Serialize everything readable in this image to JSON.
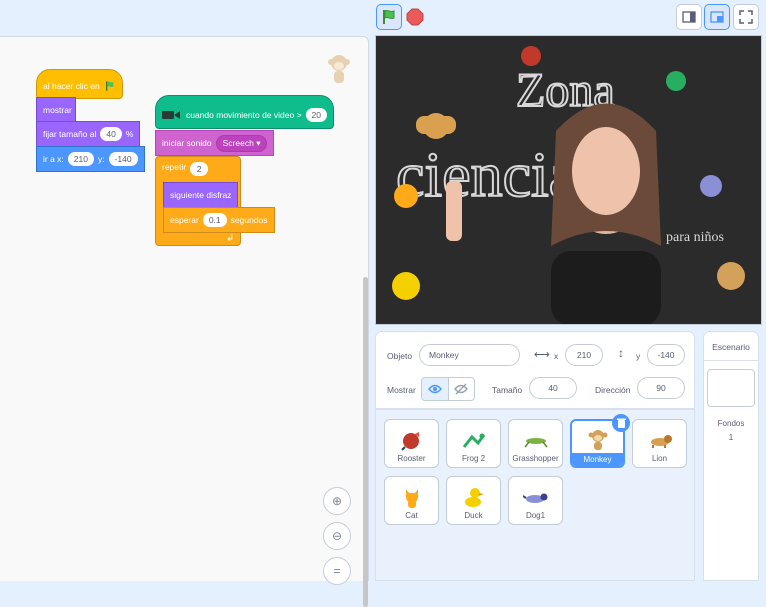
{
  "scripts": {
    "flag_script": {
      "when_flag": "al hacer clic en",
      "show": "mostrar",
      "set_size_label": "fijar tamaño al",
      "set_size_value": "40",
      "set_size_unit": "%",
      "goto_label": "ir a x:",
      "goto_x": "210",
      "goto_y_label": "y:",
      "goto_y": "-140"
    },
    "video_script": {
      "when_motion": "cuando movimiento de video >",
      "motion_value": "20",
      "start_sound": "iniciar sonido",
      "sound_name": "Screech",
      "repeat_label": "repetir",
      "repeat_value": "2",
      "next_costume": "siguiente disfraz",
      "wait_label": "esperar",
      "wait_value": "0.1",
      "wait_unit": "segundos"
    }
  },
  "sprite_info": {
    "object_label": "Objeto",
    "object_name": "Monkey",
    "x_label": "x",
    "x_value": "210",
    "y_label": "y",
    "y_value": "-140",
    "show_label": "Mostrar",
    "size_label": "Tamaño",
    "size_value": "40",
    "direction_label": "Dirección",
    "direction_value": "90"
  },
  "sprites": [
    {
      "name": "Rooster",
      "icon": "rooster-icon",
      "color": "#c0392b"
    },
    {
      "name": "Frog 2",
      "icon": "frog-icon",
      "color": "#27ae60"
    },
    {
      "name": "Grasshopper",
      "icon": "grasshopper-icon",
      "color": "#7cb342"
    },
    {
      "name": "Monkey",
      "icon": "monkey-icon",
      "color": "#d4a15a",
      "selected": true
    },
    {
      "name": "Lion",
      "icon": "lion-icon",
      "color": "#d9a050"
    },
    {
      "name": "Cat",
      "icon": "cat-icon",
      "color": "#ffab19"
    },
    {
      "name": "Duck",
      "icon": "duck-icon",
      "color": "#f5d000"
    },
    {
      "name": "Dog1",
      "icon": "dog-icon",
      "color": "#8a8fd6"
    }
  ],
  "stage_panel": {
    "title": "Escenario",
    "backdrops_label": "Fondos",
    "backdrops_count": "1"
  },
  "colors": {
    "accent": "#4c97ff",
    "event": "#ffbf00",
    "looks": "#9966ff",
    "motion": "#4c97ff",
    "sound": "#cf63cf",
    "control": "#ffab19",
    "video": "#0fbd8c"
  }
}
